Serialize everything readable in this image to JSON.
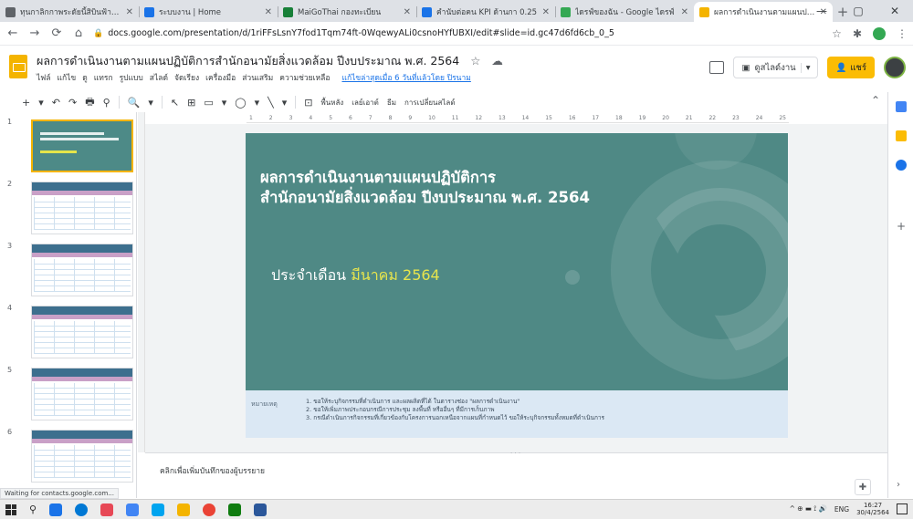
{
  "browser": {
    "tabs": [
      {
        "title": "ทุนกาลิกกาพระดัยนี้สิบินฟ้าสีคราม",
        "color": "#5f6368",
        "active": false
      },
      {
        "title": "ระบบงาน | Home",
        "color": "#1a73e8",
        "active": false
      },
      {
        "title": "MaiGoThai กองทะเบียน",
        "color": "#188038",
        "active": false
      },
      {
        "title": "คำนับต่อคน KPI ด้านกา 0.25",
        "color": "#1a73e8",
        "active": false
      },
      {
        "title": "ไดรฟ์ของฉัน - Google ไดรฟ์",
        "color": "#34a853",
        "active": false
      },
      {
        "title": "ผลการดำเนินงานตามแผนปฏิบัติ",
        "color": "#f4b400",
        "active": true
      }
    ],
    "new_tab": "+",
    "minimize": "—",
    "maximize": "▢",
    "close": "✕",
    "back": "←",
    "forward": "→",
    "reload": "⟳",
    "home": "⌂",
    "lock": "🔒",
    "url": "docs.google.com/presentation/d/1riFFsLsnY7fod1Tqm74ft-0WqewyALi0csnoHYfUBXI/edit#slide=id.gc47d6fd6cb_0_5",
    "bookmark_star": "☆",
    "extensions": "✱",
    "menu": "⋮"
  },
  "slides_app": {
    "doc_title": "ผลการดำเนินงานตามแผนปฏิบัติการสำนักอนามัยสิ่งแวดล้อม ปีงบประมาณ พ.ศ. 2564",
    "star": "☆",
    "cloud": "☁",
    "menu": [
      "ไฟล์",
      "แก้ไข",
      "ดู",
      "แทรก",
      "รูปแบบ",
      "สไลด์",
      "จัดเรียง",
      "เครื่องมือ",
      "ส่วนเสริม",
      "ความช่วยเหลือ"
    ],
    "last_edit": "แก้ไขล่าสุดเมื่อ 6 วันที่แล้วโดย ปิรนาม",
    "present_label": "ดูสไลด์งาน",
    "present_icon": "▣",
    "dropdown": "▾",
    "share_label": "แชร์",
    "share_icon": "👤"
  },
  "toolbar": {
    "items": [
      "+",
      "▾",
      "↶",
      "↷",
      "🖶",
      "⚲",
      "|",
      "🔍",
      "▾",
      "|",
      "↖",
      "⊞",
      "▭",
      "▾",
      "◯",
      "▾",
      "╲",
      "▾",
      "|",
      "⊡"
    ],
    "background_label": "พื้นหลัง",
    "layout_label": "เลย์เอาต์",
    "theme_label": "ธีม",
    "transition_label": "การเปลี่ยนสไลด์",
    "collapse": "⌃"
  },
  "filmstrip": {
    "slides": [
      {
        "num": "1",
        "kind": "title",
        "selected": true
      },
      {
        "num": "2",
        "kind": "table",
        "selected": false
      },
      {
        "num": "3",
        "kind": "table",
        "selected": false
      },
      {
        "num": "4",
        "kind": "table",
        "selected": false
      },
      {
        "num": "5",
        "kind": "table",
        "selected": false
      },
      {
        "num": "6",
        "kind": "table",
        "selected": false
      }
    ]
  },
  "ruler": [
    "1",
    "2",
    "3",
    "4",
    "5",
    "6",
    "7",
    "8",
    "9",
    "10",
    "11",
    "12",
    "13",
    "14",
    "15",
    "16",
    "17",
    "18",
    "19",
    "20",
    "21",
    "22",
    "23",
    "24",
    "25"
  ],
  "slide": {
    "title_line1": "ผลการดำเนินงานตามแผนปฏิบัติการ",
    "title_line2": "สำนักอนามัยสิ่งแวดล้อม ปีงบประมาณ พ.ศ. 2564",
    "subtitle_prefix": "ประจำเดือน ",
    "subtitle_highlight": "มีนาคม 2564",
    "background_color": "#4f8985",
    "highlight_color": "#e7e54d",
    "note_label": "หมายเหตุ",
    "notes": [
      "1. ขอให้ระบุกิจกรรมที่ดำเนินการ และผลผลิตที่ได้ ในตารางช่อง \"ผลการดำเนินงาน\"",
      "2. ขอให้เพิ่มภาพประกอบกรณีการประชุม ลงพื้นที่ หรืออื่นๆ ที่มีการเก็บภาพ",
      "3. กรณีดำเนินการกิจกรรมที่เกี่ยวข้องกับโครงการนอกเหนือจากแผนที่กำหนดไว้ ขอให้ระบุกิจกรรมทั้งหมดที่ดำเนินการ"
    ]
  },
  "speaker_notes": {
    "placeholder": "คลิกเพื่อเพิ่มบันทึกของผู้บรรยาย",
    "drag": "· · ·",
    "explore": "✚"
  },
  "side_panel": {
    "icons": [
      {
        "name": "calendar-icon",
        "color": "#4285f4"
      },
      {
        "name": "keep-icon",
        "color": "#fbbc04"
      },
      {
        "name": "tasks-icon",
        "color": "#1a73e8"
      }
    ],
    "add": "+",
    "chevron": "›"
  },
  "status_text": "Waiting for contacts.google.com...",
  "taskbar": {
    "search": "⚲",
    "apps": [
      "#1a73e8",
      "#0078d4",
      "#e74856",
      "#4285f4",
      "#00a4ef",
      "#f4b400",
      "#ea4335",
      "#107c10",
      "#2b579a"
    ],
    "tray_icons": "^ ⊕ ▬ ⟟ 🔊",
    "lang": "ENG",
    "time": "16:27",
    "date": "30/4/2564"
  }
}
